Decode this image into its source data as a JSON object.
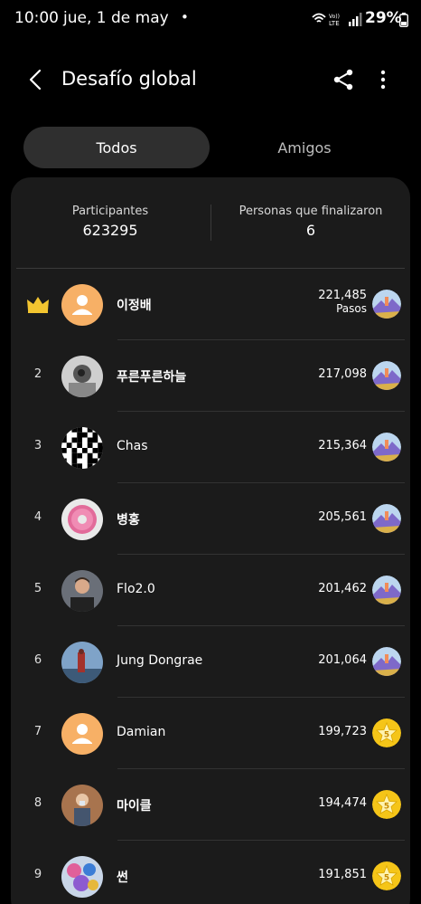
{
  "status_bar": {
    "time": "10:00",
    "date": "jue, 1 de may",
    "dot": "•",
    "battery": "29%",
    "icons": [
      "wifi-icon",
      "volte-lte-icon",
      "signal-icon",
      "battery-icon"
    ]
  },
  "app_bar": {
    "title": "Desafío global",
    "icons": [
      "back-arrow-icon",
      "share-icon",
      "more-vert-icon"
    ]
  },
  "tabs": [
    {
      "label": "Todos",
      "active": true
    },
    {
      "label": "Amigos",
      "active": false
    }
  ],
  "stats": {
    "participants_label": "Participantes",
    "participants_value": "623295",
    "finished_label": "Personas que finalizaron",
    "finished_value": "6"
  },
  "leaderboard": [
    {
      "rank": "",
      "crown": true,
      "name": "이정배",
      "bold": true,
      "steps": "221,485",
      "unit": "Pasos",
      "avatar": "default",
      "badge": "landscape"
    },
    {
      "rank": "2",
      "name": "푸른푸른하늘",
      "bold": true,
      "steps": "217,098",
      "avatar": "photo-grey",
      "badge": "landscape"
    },
    {
      "rank": "3",
      "name": "Chas",
      "bold": false,
      "steps": "215,364",
      "avatar": "qr",
      "badge": "landscape"
    },
    {
      "rank": "4",
      "name": "병홍",
      "bold": true,
      "steps": "205,561",
      "avatar": "donut",
      "badge": "landscape"
    },
    {
      "rank": "5",
      "name": "Flo2.0",
      "bold": false,
      "steps": "201,462",
      "avatar": "photo-man",
      "badge": "landscape"
    },
    {
      "rank": "6",
      "name": "Jung Dongrae",
      "bold": false,
      "steps": "201,064",
      "avatar": "photo-sky",
      "badge": "landscape"
    },
    {
      "rank": "7",
      "name": "Damian",
      "bold": false,
      "steps": "199,723",
      "avatar": "default",
      "badge": "star-5"
    },
    {
      "rank": "8",
      "name": "마이클",
      "bold": true,
      "steps": "194,474",
      "avatar": "photo-person",
      "badge": "star-5"
    },
    {
      "rank": "9",
      "name": "썬",
      "bold": true,
      "steps": "191,851",
      "avatar": "photo-colorful",
      "badge": "star-5"
    }
  ],
  "colors": {
    "background": "#000000",
    "card": "#1b1b1b",
    "active_tab": "#2f2f2f",
    "crown": "#f3c530",
    "default_avatar": "#f7b066",
    "star_badge": "#f5c518"
  }
}
